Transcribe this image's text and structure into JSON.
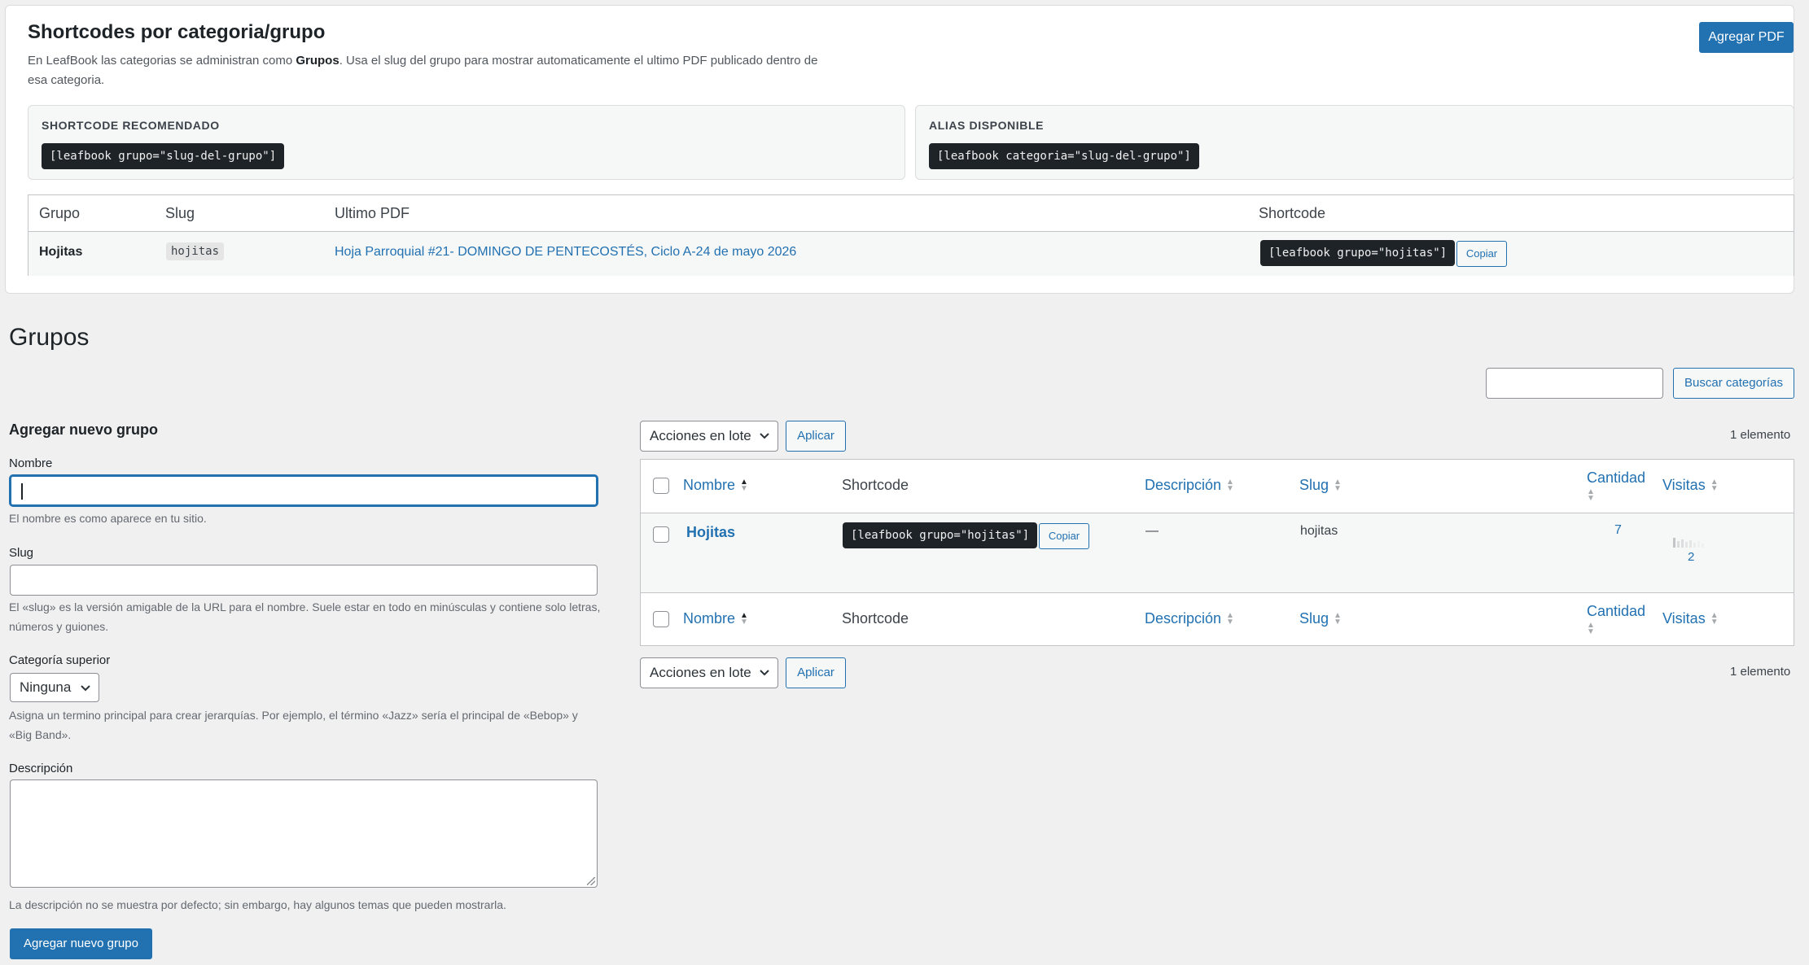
{
  "panel": {
    "title": "Shortcodes por categoria/grupo",
    "desc_before": "En LeafBook las categorias se administran como ",
    "desc_bold": "Grupos",
    "desc_after": ". Usa el slug del grupo para mostrar automaticamente el ultimo PDF publicado dentro de esa categoria.",
    "add_pdf_button": "Agregar PDF",
    "recommended": {
      "label": "SHORTCODE RECOMENDADO",
      "code": "[leafbook grupo=\"slug-del-grupo\"]"
    },
    "alias": {
      "label": "ALIAS DISPONIBLE",
      "code": "[leafbook categoria=\"slug-del-grupo\"]"
    },
    "table": {
      "headers": [
        "Grupo",
        "Slug",
        "Ultimo PDF",
        "Shortcode"
      ],
      "row": {
        "grupo": "Hojitas",
        "slug": "hojitas",
        "ultimo_pdf": "Hoja Parroquial #21- DOMINGO DE PENTECOSTÉS, Ciclo A-24 de mayo 2026",
        "shortcode": "[leafbook grupo=\"hojitas\"]",
        "copy_button": "Copiar"
      }
    }
  },
  "page": {
    "title": "Grupos",
    "search_button": "Buscar categorías",
    "search_value": ""
  },
  "form": {
    "title": "Agregar nuevo grupo",
    "nombre_label": "Nombre",
    "nombre_value": "",
    "nombre_hint": "El nombre es como aparece en tu sitio.",
    "slug_label": "Slug",
    "slug_value": "",
    "slug_hint": "El «slug» es la versión amigable de la URL para el nombre. Suele estar en todo en minúsculas y contiene solo letras, números y guiones.",
    "parent_label": "Categoría superior",
    "parent_value": "Ninguna",
    "parent_hint": "Asigna un termino principal para crear jerarquías. Por ejemplo, el término «Jazz» sería el principal de «Bebop» y «Big Band».",
    "desc_label": "Descripción",
    "desc_value": "",
    "desc_hint": "La descripción no se muestra por defecto; sin embargo, hay algunos temas que pueden mostrarla.",
    "submit_button": "Agregar nuevo grupo"
  },
  "list": {
    "bulk_actions": "Acciones en lote",
    "apply_button": "Aplicar",
    "count_text": "1 elemento",
    "columns": {
      "nombre": "Nombre",
      "shortcode": "Shortcode",
      "descripcion": "Descripción",
      "slug": "Slug",
      "cantidad": "Cantidad",
      "visitas": "Visitas"
    },
    "rows": [
      {
        "nombre": "Hojitas",
        "shortcode": "[leafbook grupo=\"hojitas\"]",
        "copy_button": "Copiar",
        "descripcion": "—",
        "slug": "hojitas",
        "cantidad": "7",
        "visitas": "2"
      }
    ]
  },
  "colors": {
    "accent": "#2271b1",
    "code_bg": "#1d2327",
    "page_bg": "#f0f0f1"
  }
}
